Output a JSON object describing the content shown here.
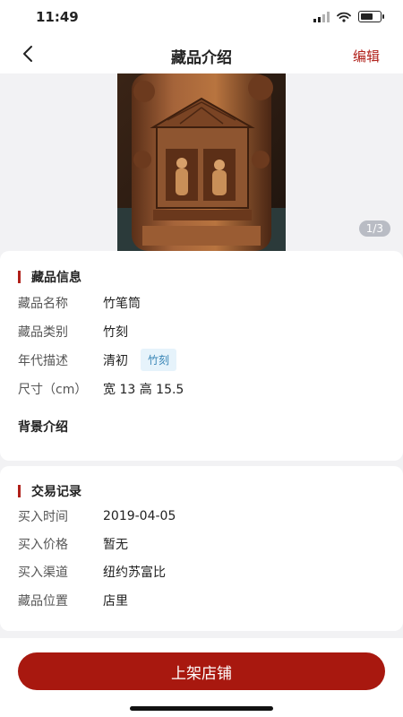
{
  "status": {
    "time": "11:49"
  },
  "nav": {
    "title": "藏品介绍",
    "edit_label": "编辑"
  },
  "gallery": {
    "counter": "1/3"
  },
  "info": {
    "title": "藏品信息",
    "rows": [
      {
        "label": "藏品名称",
        "value": "竹笔筒"
      },
      {
        "label": "藏品类别",
        "value": "竹刻"
      },
      {
        "label": "年代描述",
        "value": "清初",
        "tag": "竹刻"
      },
      {
        "label": "尺寸（cm）",
        "value": "宽 13 高 15.5"
      }
    ],
    "background_title": "背景介绍"
  },
  "trade": {
    "title": "交易记录",
    "rows": [
      {
        "label": "买入时间",
        "value": "2019-04-05"
      },
      {
        "label": "买入价格",
        "value": "暂无"
      },
      {
        "label": "买入渠道",
        "value": "纽约苏富比"
      },
      {
        "label": "藏品位置",
        "value": "店里"
      }
    ]
  },
  "footer": {
    "button_label": "上架店铺"
  },
  "colors": {
    "accent": "#b0201a",
    "button": "#a8180f"
  }
}
